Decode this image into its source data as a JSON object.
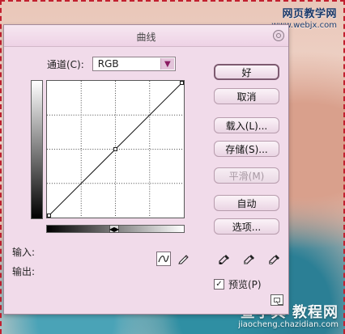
{
  "watermarks": {
    "top_chinese": "网页教学网",
    "top_url": "www.webjx.com",
    "bottom_chinese": "查字典 教程网",
    "bottom_url": "jiaocheng.chazidian.com"
  },
  "dialog": {
    "title": "曲线",
    "channel_label": "通道(C):",
    "channel_value": "RGB",
    "input_label": "输入:",
    "output_label": "输出:",
    "buttons": {
      "ok": "好",
      "cancel": "取消",
      "load": "载入(L)...",
      "save": "存储(S)...",
      "smooth": "平滑(M)",
      "auto": "自动",
      "options": "选项..."
    },
    "preview_label": "预览(P)",
    "preview_checked": true
  },
  "colors": {
    "dialog_bg": "#f1dbea",
    "accent": "#8a1b62",
    "dashed_border": "#c21f2f"
  },
  "icons": {
    "close": "close-icon",
    "dropdown": "chevron-down-icon",
    "curve_tool": "curve-tool-icon",
    "pencil_tool": "pencil-icon",
    "eyedropper_black": "eyedropper-black-icon",
    "eyedropper_gray": "eyedropper-gray-icon",
    "eyedropper_white": "eyedropper-white-icon",
    "options": "expand-options-icon"
  }
}
